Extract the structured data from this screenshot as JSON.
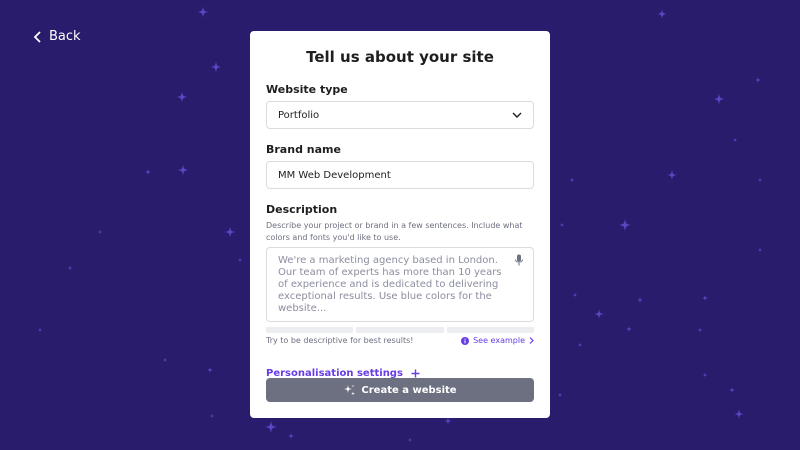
{
  "nav": {
    "back_label": "Back"
  },
  "form": {
    "title": "Tell us about your site",
    "website_type": {
      "label": "Website type",
      "value": "Portfolio"
    },
    "brand_name": {
      "label": "Brand name",
      "value": "MM Web Development"
    },
    "description": {
      "label": "Description",
      "help": "Describe your project or brand in a few sentences. Include what colors and fonts you'd like to use.",
      "placeholder": "We're a marketing agency based in London. Our team of experts has more than 10 years of experience and is dedicated to delivering exceptional results. Use blue colors for the website..."
    },
    "hint": "Try to be descriptive for best results!",
    "see_example": "See example",
    "personalisation": "Personalisation settings",
    "create_button": "Create a website"
  },
  "colors": {
    "background": "#2a1c6d",
    "accent": "#673de6",
    "button_disabled": "#6d7081"
  },
  "icons": [
    "chevron-left-icon",
    "chevron-down-icon",
    "microphone-icon",
    "info-icon",
    "chevron-right-icon",
    "plus-icon",
    "sparkle-icon"
  ]
}
